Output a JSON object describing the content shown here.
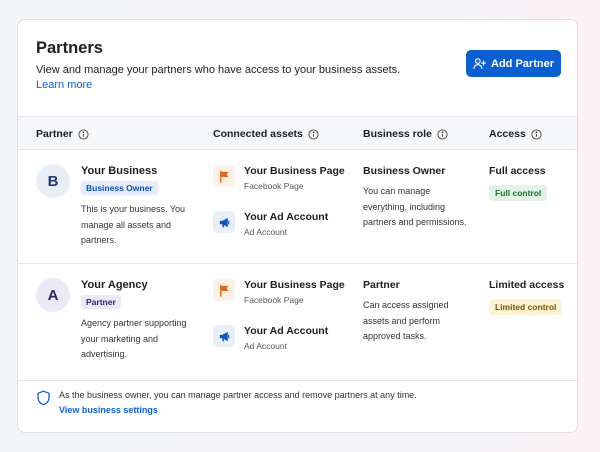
{
  "header": {
    "title": "Partners",
    "description": "View and manage your partners who have access to your business assets.",
    "learn_more": "Learn more",
    "add_button": "Add Partner"
  },
  "table": {
    "columns": [
      "Partner",
      "Connected assets",
      "Business role",
      "Access"
    ],
    "rows": [
      {
        "avatar": "B",
        "name": "Your Business",
        "badge": "Business Owner",
        "description": "This is your business. You manage all assets and partners.",
        "assets": [
          {
            "name": "Your Business Page",
            "type": "Facebook Page",
            "icon": "flag-icon"
          },
          {
            "name": "Your Ad Account",
            "type": "Ad Account",
            "icon": "megaphone-icon"
          }
        ],
        "role": "Business Owner",
        "role_description": "You can manage everything, including partners and permissions.",
        "access": "Full access",
        "access_badge": "Full control"
      },
      {
        "avatar": "A",
        "name": "Your Agency",
        "badge": "Partner",
        "description": "Agency partner supporting your marketing and advertising.",
        "assets": [
          {
            "name": "Your Business Page",
            "type": "Facebook Page",
            "icon": "flag-icon"
          },
          {
            "name": "Your Ad Account",
            "type": "Ad Account",
            "icon": "megaphone-icon"
          }
        ],
        "role": "Partner",
        "role_description": "Can access assigned assets and perform approved tasks.",
        "access": "Limited access",
        "access_badge": "Limited control"
      }
    ]
  },
  "footer": {
    "text": "As the business owner, you can manage partner access and remove partners at any time.",
    "link": "View business settings"
  },
  "colors": {
    "primary": "#0b5fcf",
    "link": "#0b5ed7",
    "full_control_bg": "#e2f3e5",
    "limited_control_bg": "#fdf2d3"
  }
}
